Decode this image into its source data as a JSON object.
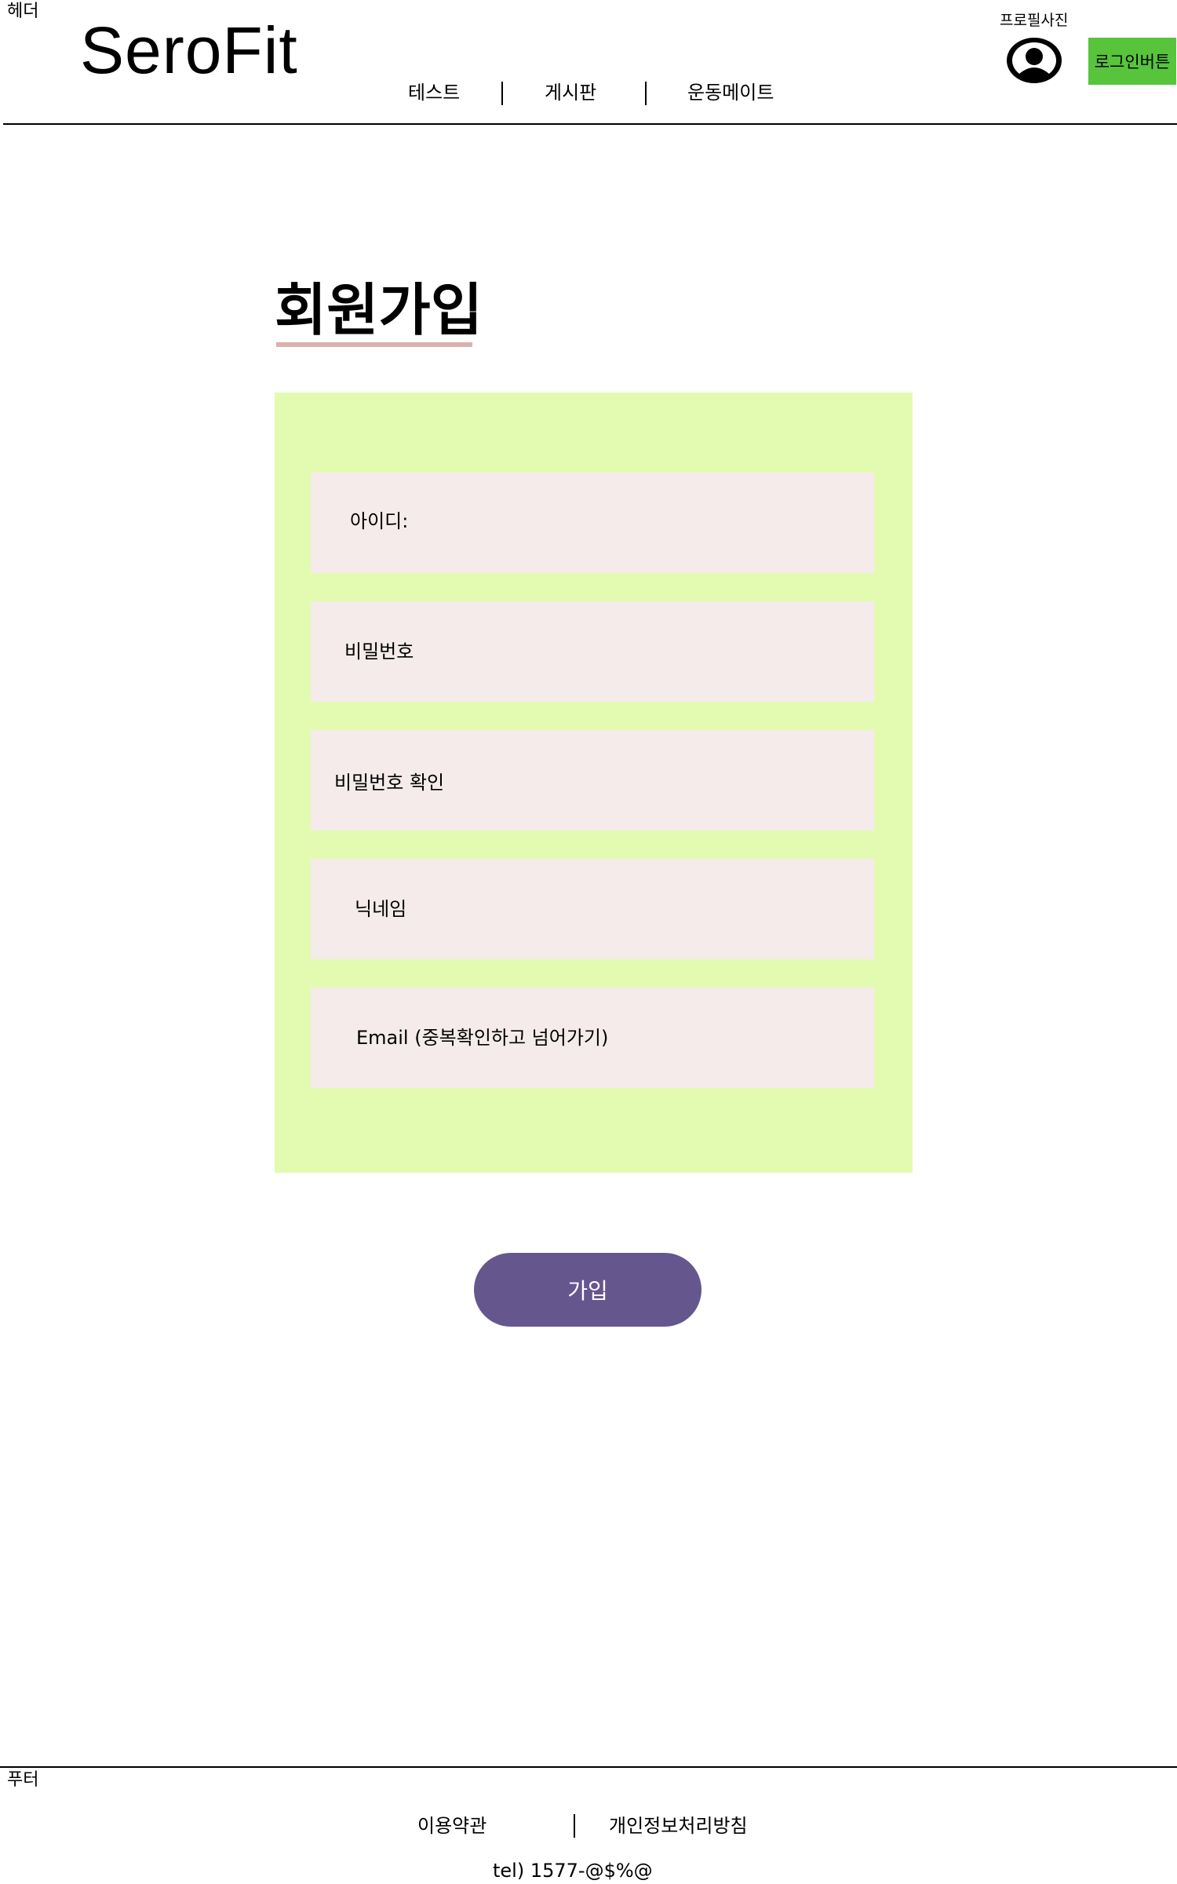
{
  "header": {
    "section_label": "헤더",
    "logo": "SeroFit",
    "nav": [
      "테스트",
      "게시판",
      "운동메이트"
    ],
    "profile_label": "프로필사진",
    "profile_icon": "user-circle-icon",
    "login_label": "로그인버튼"
  },
  "signup": {
    "title": "회원가입",
    "fields": [
      "아이디:",
      "비밀번호",
      "비밀번호 확인",
      "닉네임",
      "Email (중복확인하고 넘어가기)"
    ],
    "submit_label": "가입"
  },
  "footer": {
    "section_label": "푸터",
    "links": [
      "이용약관",
      "개인정보처리방침"
    ],
    "tel": "tel) 1577-@$%@"
  },
  "colors": {
    "login_button": "#57c43c",
    "form_panel": "#e3fbb1",
    "field_background": "#f5ebeb",
    "submit_button": "#66568e",
    "title_underline": "#d8b2b0"
  }
}
